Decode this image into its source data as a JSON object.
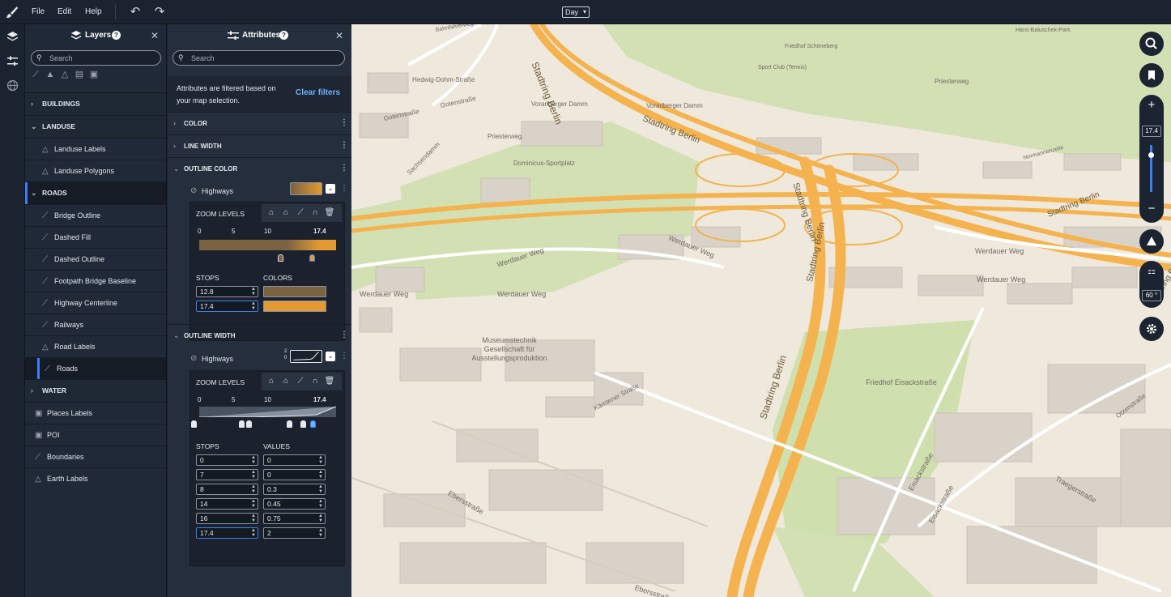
{
  "topbar": {
    "menus": [
      "File",
      "Edit",
      "Help"
    ],
    "style_select": "Day"
  },
  "layers_panel": {
    "title": "Layers",
    "search_placeholder": "Search",
    "tool_icons": [
      "line-icon",
      "symbol-icon",
      "fill-icon",
      "building-icon",
      "image-icon"
    ],
    "groups": [
      {
        "label": "BUILDINGS",
        "expanded": false
      },
      {
        "label": "LANDUSE",
        "expanded": true,
        "children": [
          {
            "label": "Landuse Labels",
            "icon": "symbol-icon"
          },
          {
            "label": "Landuse Polygons",
            "icon": "fill-icon"
          }
        ]
      },
      {
        "label": "ROADS",
        "expanded": true,
        "children": [
          {
            "label": "Bridge Outline",
            "icon": "line-icon"
          },
          {
            "label": "Dashed Fill",
            "icon": "line-icon"
          },
          {
            "label": "Dashed Outline",
            "icon": "line-icon"
          },
          {
            "label": "Footpath Bridge Baseline",
            "icon": "line-icon"
          },
          {
            "label": "Highway Centerline",
            "icon": "line-icon"
          },
          {
            "label": "Railways",
            "icon": "line-icon"
          },
          {
            "label": "Road Labels",
            "icon": "symbol-icon"
          },
          {
            "label": "Roads",
            "icon": "line-icon"
          }
        ]
      },
      {
        "label": "WATER",
        "expanded": false
      }
    ],
    "top_layers": [
      {
        "label": "Places Labels",
        "icon": "image-icon"
      },
      {
        "label": "POI",
        "icon": "image-icon"
      },
      {
        "label": "Boundaries",
        "icon": "line-icon"
      },
      {
        "label": "Earth Labels",
        "icon": "symbol-icon"
      }
    ]
  },
  "attributes_panel": {
    "title": "Attributes",
    "search_placeholder": "Search",
    "filter_text": "Attributes are filtered based on your map selection.",
    "clear_filters": "Clear filters",
    "sections": {
      "color": "COLOR",
      "line_width": "LINE WIDTH",
      "outline_color": "OUTLINE COLOR",
      "outline_width": "OUTLINE WIDTH"
    },
    "outline_color": {
      "feature": "Highways",
      "zoom_label": "ZOOM LEVELS",
      "ticks": [
        "0",
        "5",
        "10",
        "17.4"
      ],
      "stops_label": "STOPS",
      "colors_label": "COLORS",
      "stops": [
        {
          "stop": "12.8",
          "color": "#7b6241"
        },
        {
          "stop": "17.4",
          "color": "#e39a33"
        }
      ]
    },
    "outline_width": {
      "feature": "Highways",
      "zoom_label": "ZOOM LEVELS",
      "ticks": [
        "0",
        "5",
        "10",
        "17.4"
      ],
      "stops_label": "STOPS",
      "values_label": "VALUES",
      "mini_axis": [
        "2",
        "0"
      ],
      "stops": [
        {
          "stop": "0",
          "value": "0"
        },
        {
          "stop": "7",
          "value": "0"
        },
        {
          "stop": "8",
          "value": "0.3"
        },
        {
          "stop": "14",
          "value": "0.45"
        },
        {
          "stop": "16",
          "value": "0.75"
        },
        {
          "stop": "17.4",
          "value": "2"
        }
      ]
    }
  },
  "map": {
    "zoom": "17.4",
    "zoom_fraction": 0.79,
    "pitch": "60 °",
    "labels": [
      {
        "text": "Stadtring Berlin"
      },
      {
        "text": "Stadtring Berlin"
      },
      {
        "text": "Stadtring Berlin"
      },
      {
        "text": "Stadtring Berlin"
      },
      {
        "text": "Stadtring Berlin"
      },
      {
        "text": "Stadtring Berlin"
      },
      {
        "text": "Stadtring Berlin"
      },
      {
        "text": "Werdauer Weg"
      },
      {
        "text": "Werdauer Weg"
      },
      {
        "text": "Werdauer Weg"
      },
      {
        "text": "Werdauer Weg"
      },
      {
        "text": "Werdauer Weg"
      },
      {
        "text": "Werdauer Weg"
      },
      {
        "text": "Vorarlberger Damm"
      },
      {
        "text": "Vorarlberger Damm"
      },
      {
        "text": "Priesterweg"
      },
      {
        "text": "Priesterweg"
      },
      {
        "text": "Dominicus-Sportplatz"
      },
      {
        "text": "Sachsendamm"
      },
      {
        "text": "Gotenstraße"
      },
      {
        "text": "Gotenstraße"
      },
      {
        "text": "Hedwig-Dohm-Straße"
      },
      {
        "text": "Museumstechnik Gesellschaft für Ausstellungsproduktion"
      },
      {
        "text": "Friedhof Eisackstraße"
      },
      {
        "text": "Kärntener Straße"
      },
      {
        "text": "Ebersstraße"
      },
      {
        "text": "Ebersstraße"
      },
      {
        "text": "Eisackstraße"
      },
      {
        "text": "Eisackstraße"
      },
      {
        "text": "Traegerstraße"
      },
      {
        "text": "Otzenstraße"
      },
      {
        "text": "Normannenzeile"
      },
      {
        "text": "Friedhof Schöneberg"
      },
      {
        "text": "Sport Club (Tennis)"
      },
      {
        "text": "Hans-Baluschek-Park"
      },
      {
        "text": "Bahnfahrerweg"
      }
    ]
  }
}
